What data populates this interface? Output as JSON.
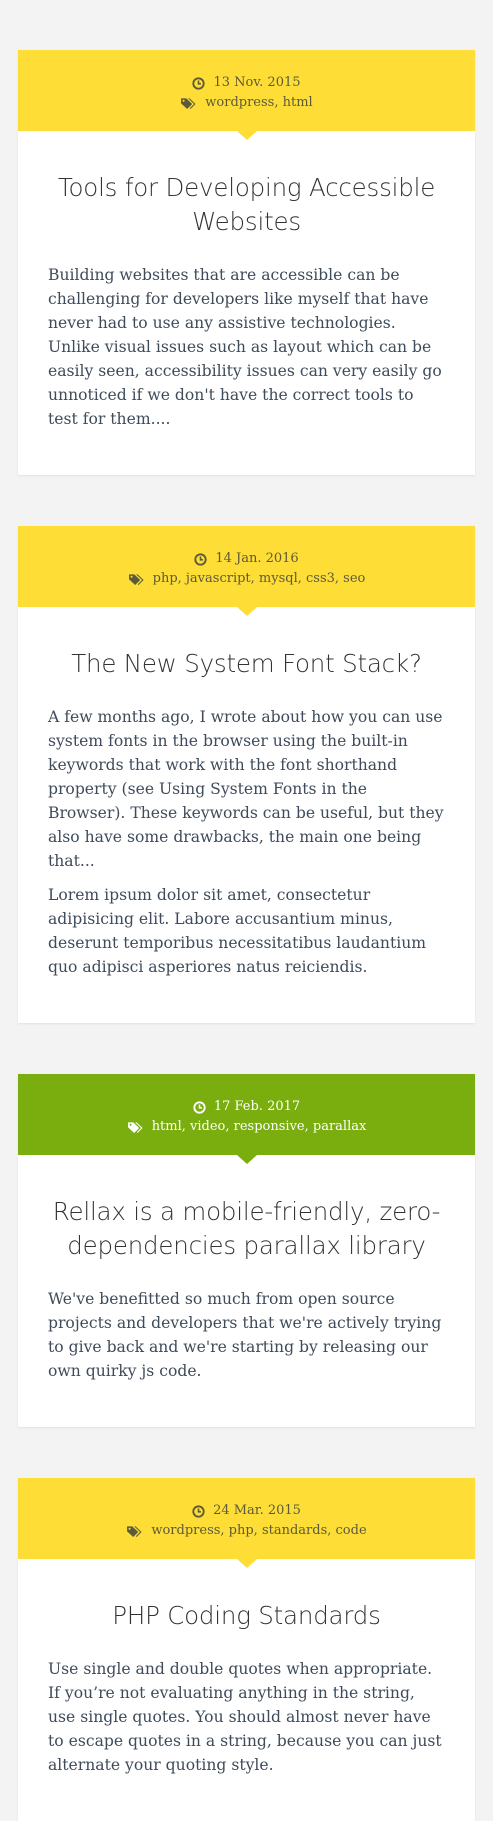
{
  "colors": {
    "page_background": "#f3f3f3",
    "header_yellow": "#fddd36",
    "header_green": "#7aae0e",
    "text_on_yellow": "#5d5a3c",
    "text_on_green": "#ffffff",
    "title_text": "#333333",
    "body_text": "#3e4b5a"
  },
  "icons": {
    "date": "clock-icon",
    "tags": "tags-icon"
  },
  "posts": [
    {
      "header_color": "#fddd36",
      "date": "13 Nov. 2015",
      "tags": "wordpress, html",
      "title": "Tools for Developing Accessible Websites",
      "paragraphs": [
        "Building websites that are accessible can be challenging for developers like myself that have never had to use any assistive technologies. Unlike visual issues such as layout which can be easily seen, accessibility issues can very easily go unnoticed if we don't have the correct tools to test for them...."
      ]
    },
    {
      "header_color": "#fddd36",
      "date": "14 Jan. 2016",
      "tags": "php, javascript, mysql, css3, seo",
      "title": "The New System Font Stack?",
      "paragraphs": [
        "A few months ago, I wrote about how you can use system fonts in the browser using the built-in keywords that work with the font shorthand property (see Using System Fonts in the Browser). These keywords can be useful, but they also have some drawbacks, the main one being that...",
        "Lorem ipsum dolor sit amet, consectetur adipisicing elit. Labore accusantium minus, deserunt temporibus necessitatibus laudantium quo adipisci asperiores natus reiciendis."
      ]
    },
    {
      "header_color": "#7aae0e",
      "date": "17 Feb. 2017",
      "tags": "html, video, responsive, parallax",
      "title": "Rellax is a mobile-friendly, zero-dependencies parallax library",
      "paragraphs": [
        "We've benefitted so much from open source projects and developers that we're actively trying to give back and we're starting by releasing our own quirky js code."
      ]
    },
    {
      "header_color": "#fddd36",
      "date": "24 Mar. 2015",
      "tags": "wordpress, php, standards, code",
      "title": "PHP Coding Standards",
      "paragraphs": [
        "Use single and double quotes when appropriate. If you’re not evaluating anything in the string, use single quotes. You should almost never have to escape quotes in a string, because you can just alternate your quoting style."
      ]
    }
  ]
}
